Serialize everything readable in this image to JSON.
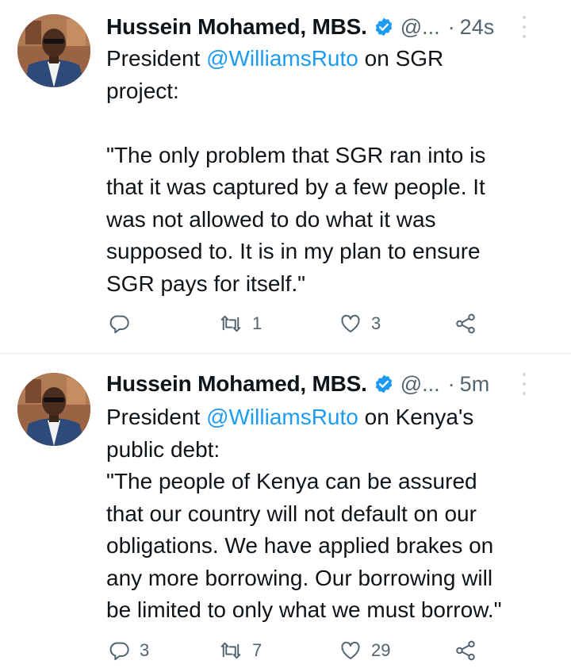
{
  "tweets": [
    {
      "author": {
        "name": "Hussein Mohamed, MBS.",
        "handle": "@...",
        "verified": true
      },
      "time": "24s",
      "text_pre": "President ",
      "mention": "@WilliamsRuto",
      "text_post": " on SGR\nproject:\n\n\"The only problem that SGR ran into is\nthat it was captured by a few people. It\nwas not allowed to do what it was\nsupposed to. It is in my plan to ensure\nSGR pays for itself.\"",
      "replies": "",
      "retweets": "1",
      "likes": "3"
    },
    {
      "author": {
        "name": "Hussein Mohamed, MBS.",
        "handle": "@...",
        "verified": true
      },
      "time": "5m",
      "text_pre": "President ",
      "mention": "@WilliamsRuto",
      "text_post": " on Kenya's\npublic debt:\n\"The people of Kenya can be assured\nthat our country will not default on our\nobligations. We have applied brakes on\nany more borrowing. Our borrowing will\nbe limited to only what we must borrow.\"",
      "replies": "3",
      "retweets": "7",
      "likes": "29"
    }
  ],
  "colors": {
    "accent": "#1d9bf0",
    "muted": "#536471",
    "divider": "#e6ecf0"
  },
  "icons": [
    "verified-badge-icon",
    "more-icon",
    "reply-icon",
    "retweet-icon",
    "like-icon",
    "share-icon"
  ]
}
